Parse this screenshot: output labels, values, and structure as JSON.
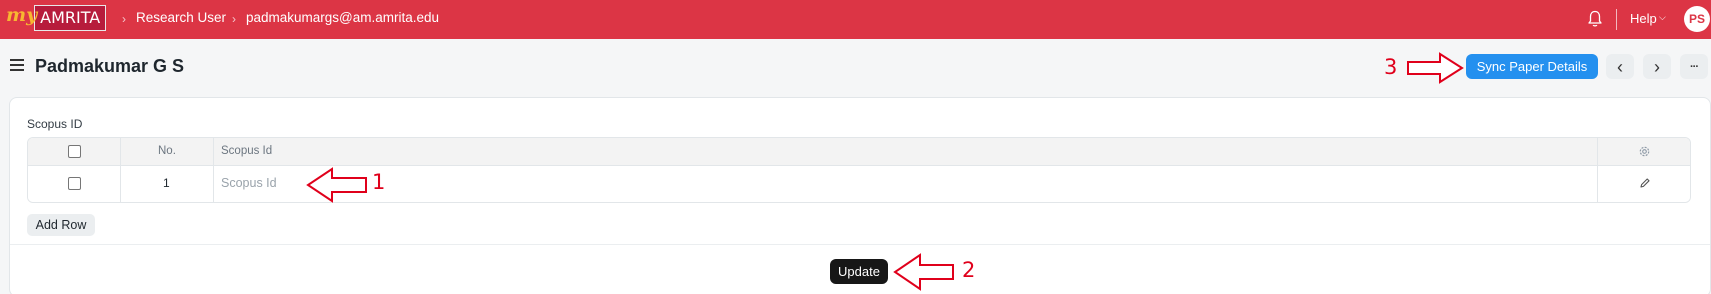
{
  "navbar": {
    "logo_prefix": "my",
    "logo_text": "AMRITA",
    "breadcrumbs": [
      {
        "label": "Research User"
      },
      {
        "label": "padmakumargs@am.amrita.edu"
      }
    ],
    "help_label": "Help",
    "avatar_initials": "PS"
  },
  "header": {
    "title": "Padmakumar G S",
    "sync_button_label": "Sync Paper Details",
    "prev_icon": "‹",
    "next_icon": "›",
    "more_icon": "···"
  },
  "form": {
    "field_label": "Scopus ID",
    "table": {
      "columns": [
        "No.",
        "Scopus Id"
      ],
      "rows": [
        {
          "no": "1",
          "scopus_id_placeholder": "Scopus Id"
        }
      ]
    },
    "add_row_label": "Add Row",
    "update_button_label": "Update"
  },
  "annotations": {
    "label_1": "1",
    "label_2": "2",
    "label_3": "3"
  },
  "colors": {
    "navbar": "#dc3545",
    "primary_button": "#2490ef",
    "annotation": "#e0001b"
  }
}
